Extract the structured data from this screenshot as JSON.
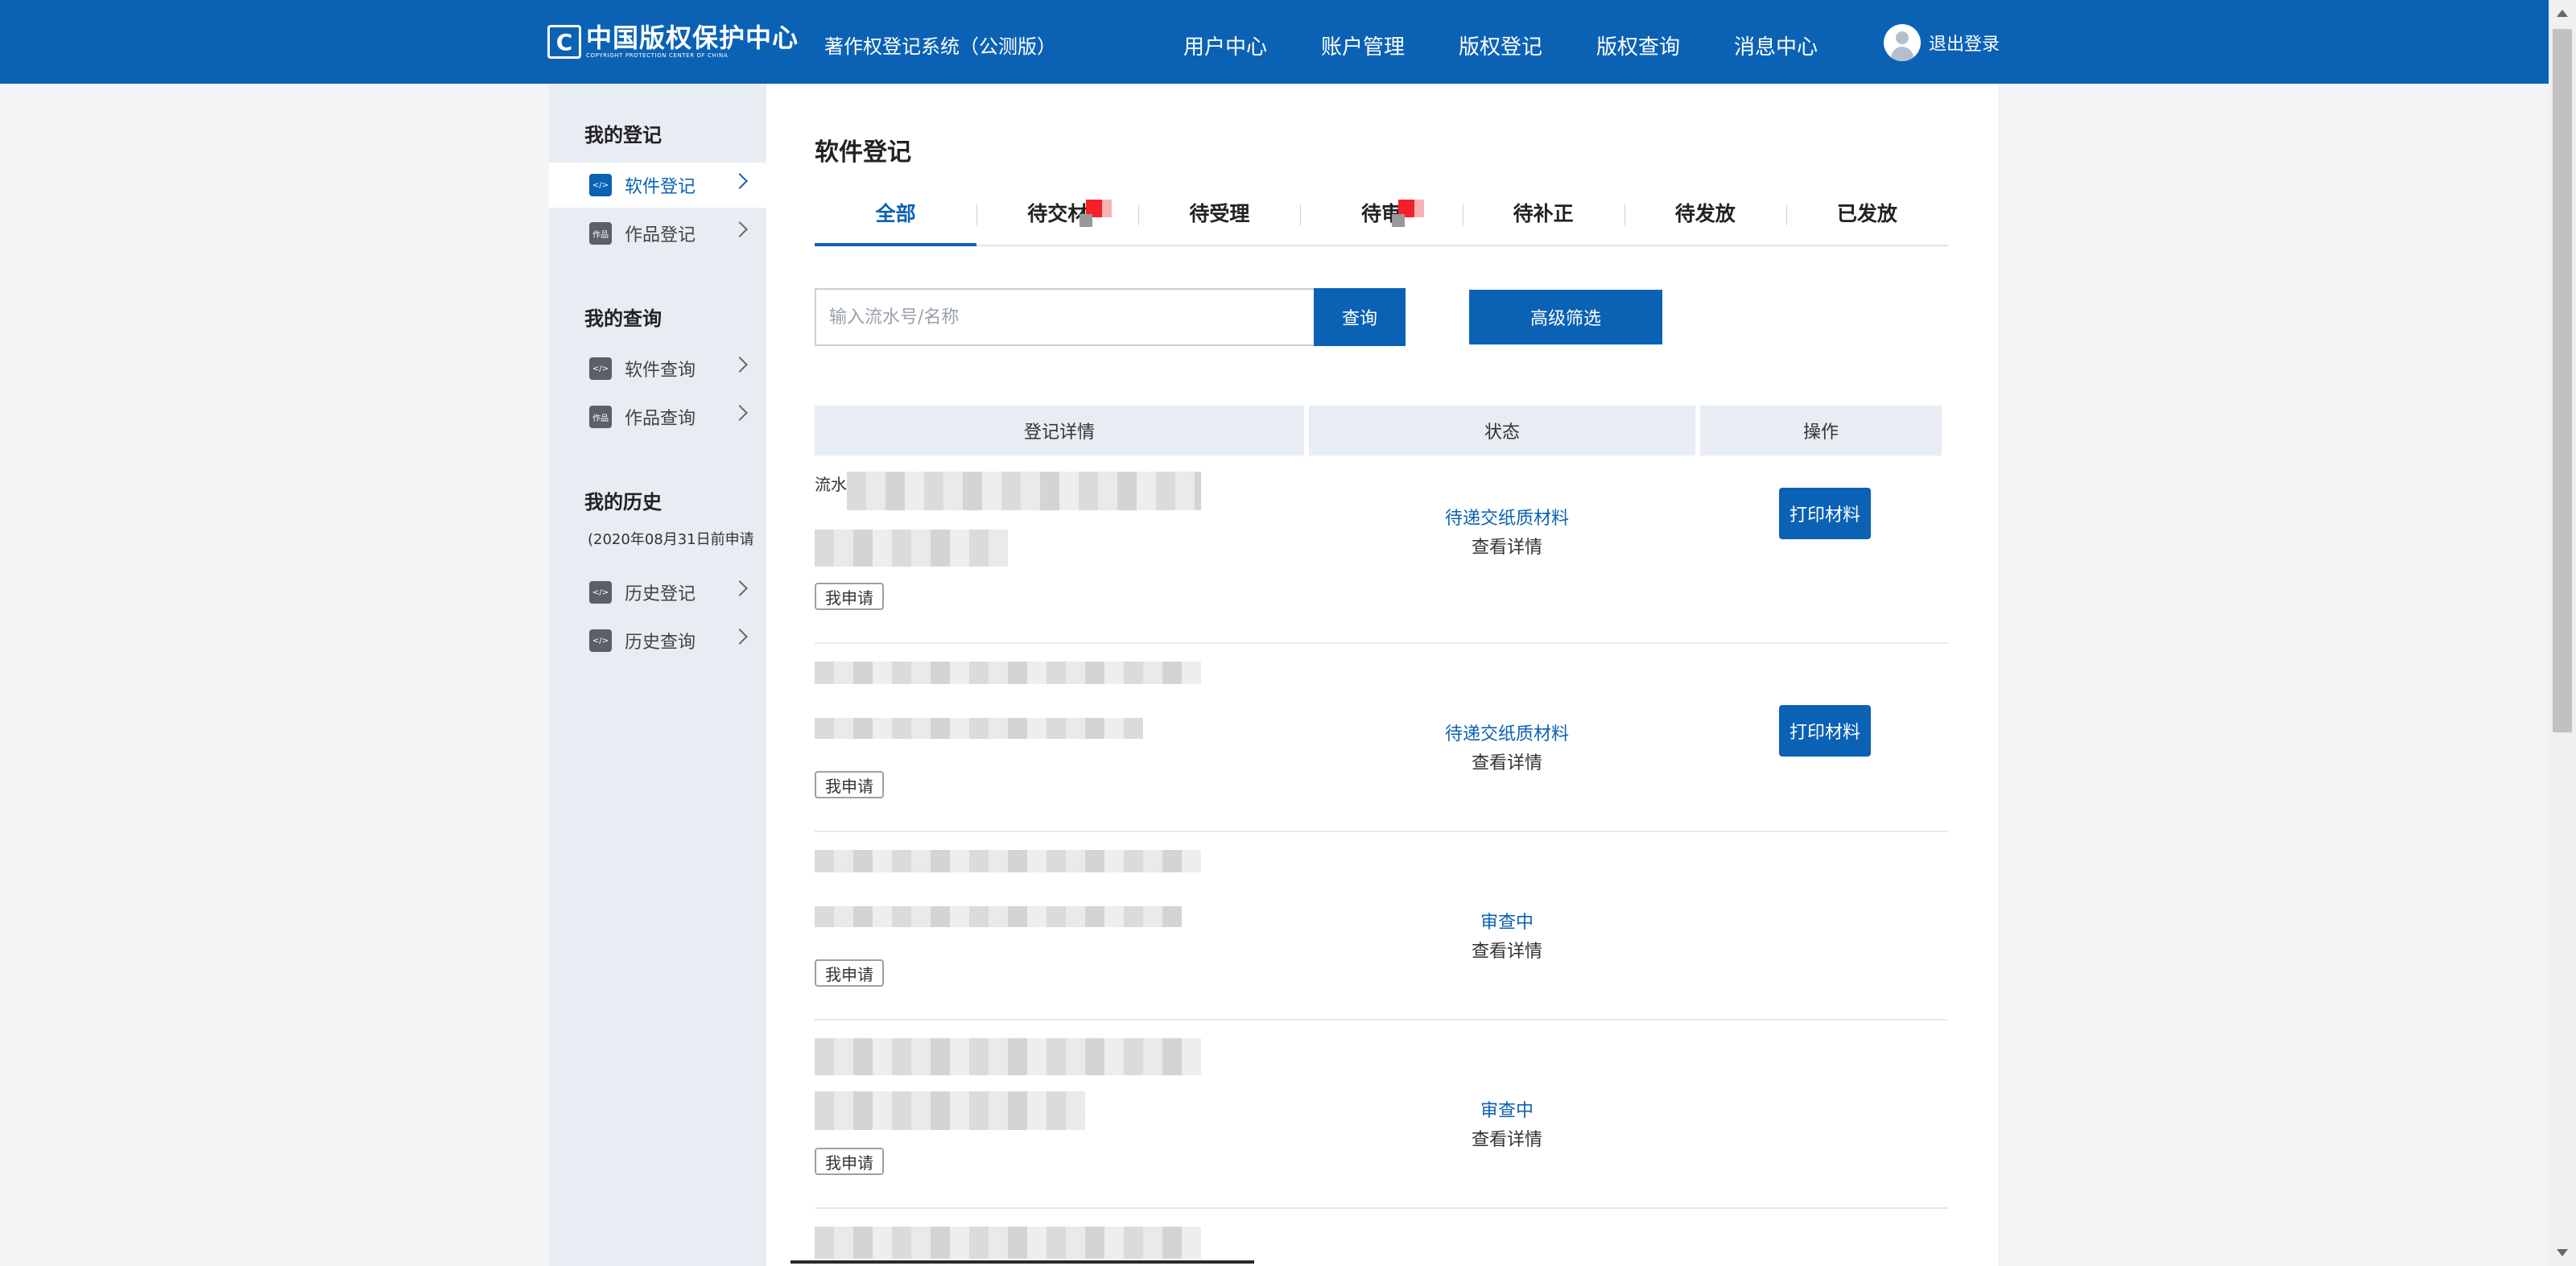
{
  "header": {
    "logo_cn": "中国版权保护中心",
    "logo_en": "COPYRIGHT PROTECTION CENTER OF CHINA",
    "logo_mark": "C",
    "system_title": "著作权登记系统（公测版）",
    "nav": [
      "用户中心",
      "账户管理",
      "版权登记",
      "版权查询",
      "消息中心"
    ],
    "logout": "退出登录"
  },
  "sidebar": {
    "group_register": "我的登记",
    "group_query": "我的查询",
    "group_history": "我的历史",
    "history_note": "(2020年08月31日前申请",
    "items": [
      {
        "label": "软件登记",
        "icon": "software-icon",
        "icon_text": "</>",
        "active": true
      },
      {
        "label": "作品登记",
        "icon": "works-icon",
        "icon_text": "作品",
        "active": false
      },
      {
        "label": "软件查询",
        "icon": "software-icon",
        "icon_text": "</>",
        "active": false
      },
      {
        "label": "作品查询",
        "icon": "works-icon",
        "icon_text": "作品",
        "active": false
      },
      {
        "label": "历史登记",
        "icon": "software-icon",
        "icon_text": "</>",
        "active": false
      },
      {
        "label": "历史查询",
        "icon": "software-icon",
        "icon_text": "</>",
        "active": false
      }
    ]
  },
  "main": {
    "title": "软件登记",
    "tabs": [
      "全部",
      "待交材",
      "待受理",
      "待审",
      "待补正",
      "待发放",
      "已发放"
    ],
    "active_tab": "全部",
    "search_placeholder": "输入流水号/名称",
    "search_button": "查询",
    "filter_button": "高级筛选",
    "columns": [
      "登记详情",
      "状态",
      "操作"
    ],
    "flow_label": "流水",
    "rows": [
      {
        "tag": "我申请",
        "status": "待递交纸质材料",
        "detail": "查看详情",
        "action": "打印材料"
      },
      {
        "tag": "我申请",
        "status": "待递交纸质材料",
        "detail": "查看详情",
        "action": "打印材料"
      },
      {
        "tag": "我申请",
        "status": "审查中",
        "detail": "查看详情",
        "action": ""
      },
      {
        "tag": "我申请",
        "status": "审查中",
        "detail": "查看详情",
        "action": ""
      }
    ]
  },
  "colors": {
    "primary": "#0b62b5",
    "sidebar_bg": "#e8ecf3",
    "page_bg": "#f3f4f6"
  }
}
